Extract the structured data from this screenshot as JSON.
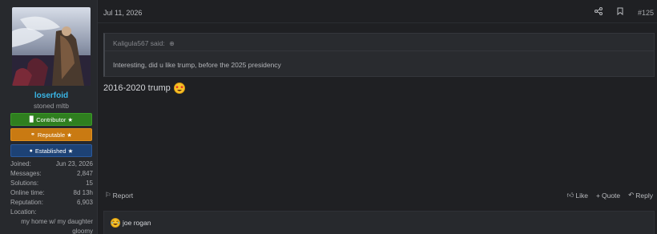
{
  "user": {
    "name": "loserfoid",
    "title": "stoned mltb",
    "badges": [
      {
        "label": "Contributor ★",
        "icon": "book-icon",
        "color": "#2f7f1f"
      },
      {
        "label": "Reputable ★",
        "icon": "handshake-icon",
        "color": "#c97a12"
      },
      {
        "label": "Established ★",
        "icon": "user-icon",
        "color": "#1d4275"
      }
    ],
    "stats": {
      "joined_label": "Joined:",
      "joined": "Jun 23, 2026",
      "messages_label": "Messages:",
      "messages": "2,847",
      "solutions_label": "Solutions:",
      "solutions": "15",
      "online_label": "Online time:",
      "online": "8d 13h",
      "reputation_label": "Reputation:",
      "reputation": "6,903",
      "location_label": "Location:",
      "location_line1": "my home w/ my daughter",
      "location_line2": "gloomy"
    }
  },
  "post": {
    "date": "Jul 11, 2026",
    "number": "#125",
    "quote": {
      "author": "Kaligula567 said:",
      "text": "Interesting, did u like trump, before the 2025 presidency"
    },
    "message": "2016-2020 trump",
    "emoji": "star-struck-emoji"
  },
  "actions": {
    "report": "Report",
    "like": "Like",
    "quote": "Quote",
    "reply": "Reply"
  },
  "signature": {
    "text": "joe rogan",
    "emoji": "laughing-emoji"
  },
  "colors": {
    "username": "#39b6e6",
    "background": "#1f2023"
  }
}
